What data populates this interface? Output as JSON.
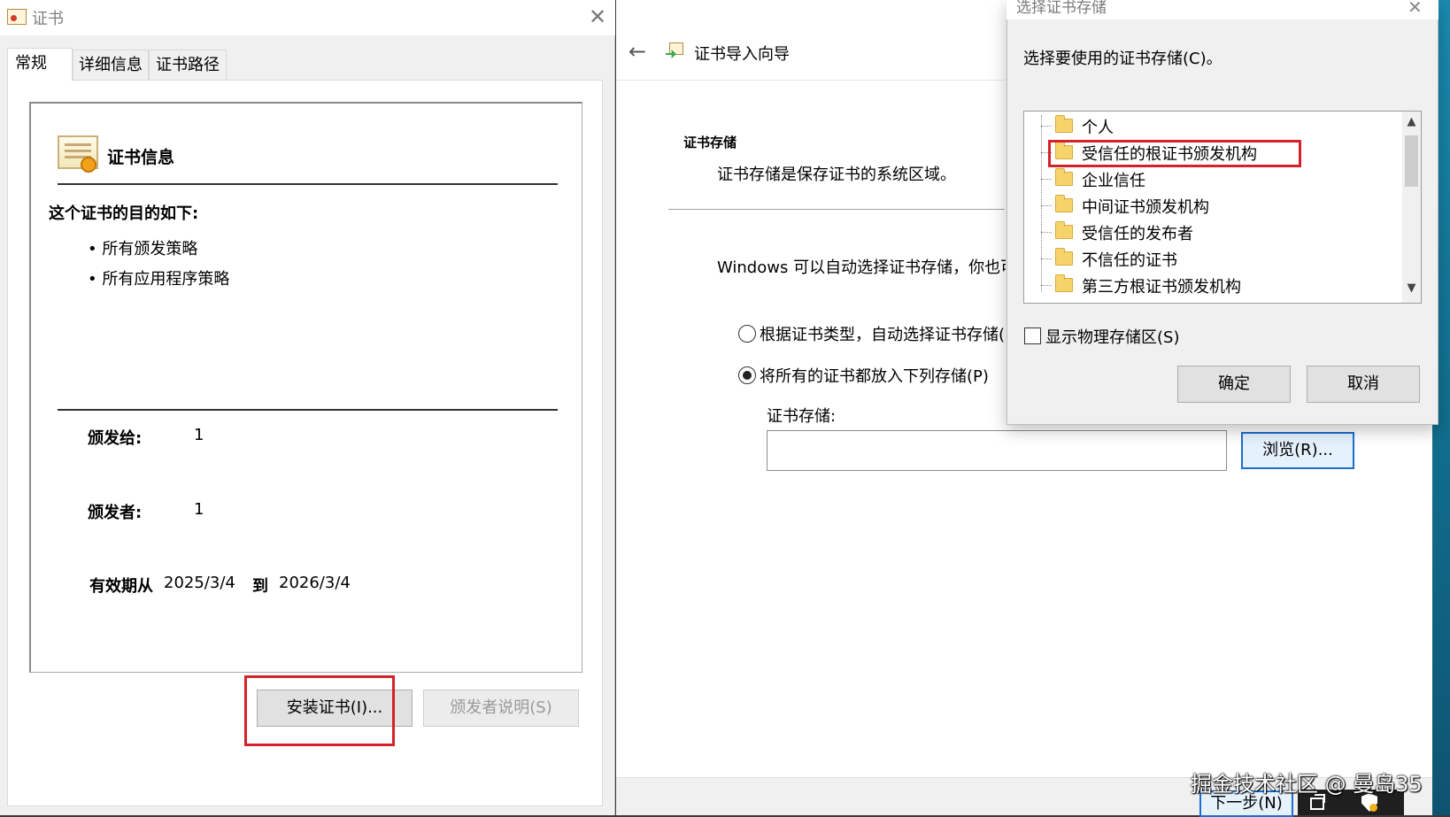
{
  "cert_window": {
    "title": "证书",
    "tabs": [
      "常规",
      "详细信息",
      "证书路径"
    ],
    "info_heading": "证书信息",
    "purpose_heading": "这个证书的目的如下:",
    "purposes": [
      "所有颁发策略",
      "所有应用程序策略"
    ],
    "issued_to_label": "颁发给:",
    "issued_to_value": "1",
    "issued_by_label": "颁发者:",
    "issued_by_value": "1",
    "valid_from_label": "有效期从",
    "valid_from_value": "2025/3/4",
    "valid_to_label": "到",
    "valid_to_value": "2026/3/4",
    "install_button": "安装证书(I)...",
    "issuer_statement_button": "颁发者说明(S)"
  },
  "wizard": {
    "title": "证书导入向导",
    "store_section_title": "证书存储",
    "store_section_desc": "证书存储是保存证书的系统区域。",
    "windows_auto_text": "Windows 可以自动选择证书存储，你也可",
    "radio_auto_label": "根据证书类型，自动选择证书存储(",
    "radio_place_label": "将所有的证书都放入下列存储(P)",
    "store_field_label": "证书存储:",
    "store_field_value": "",
    "browse_button": "浏览(R)...",
    "next_button": "下一步(N)"
  },
  "store_dialog": {
    "title": "选择证书存储",
    "prompt": "选择要使用的证书存储(C)。",
    "stores": [
      "个人",
      "受信任的根证书颁发机构",
      "企业信任",
      "中间证书颁发机构",
      "受信任的发布者",
      "不信任的证书",
      "第三方根证书颁发机构"
    ],
    "show_physical_label": "显示物理存储区(S)",
    "ok_button": "确定",
    "cancel_button": "取消"
  },
  "watermark": "掘金技术社区 @ 曼岛35",
  "icons": {
    "close": "close-icon",
    "back": "back-arrow-icon",
    "folder": "folder-icon",
    "certificate": "certificate-icon"
  },
  "colors": {
    "highlight": "#d4222a",
    "focus_blue": "#1e6ed2"
  }
}
